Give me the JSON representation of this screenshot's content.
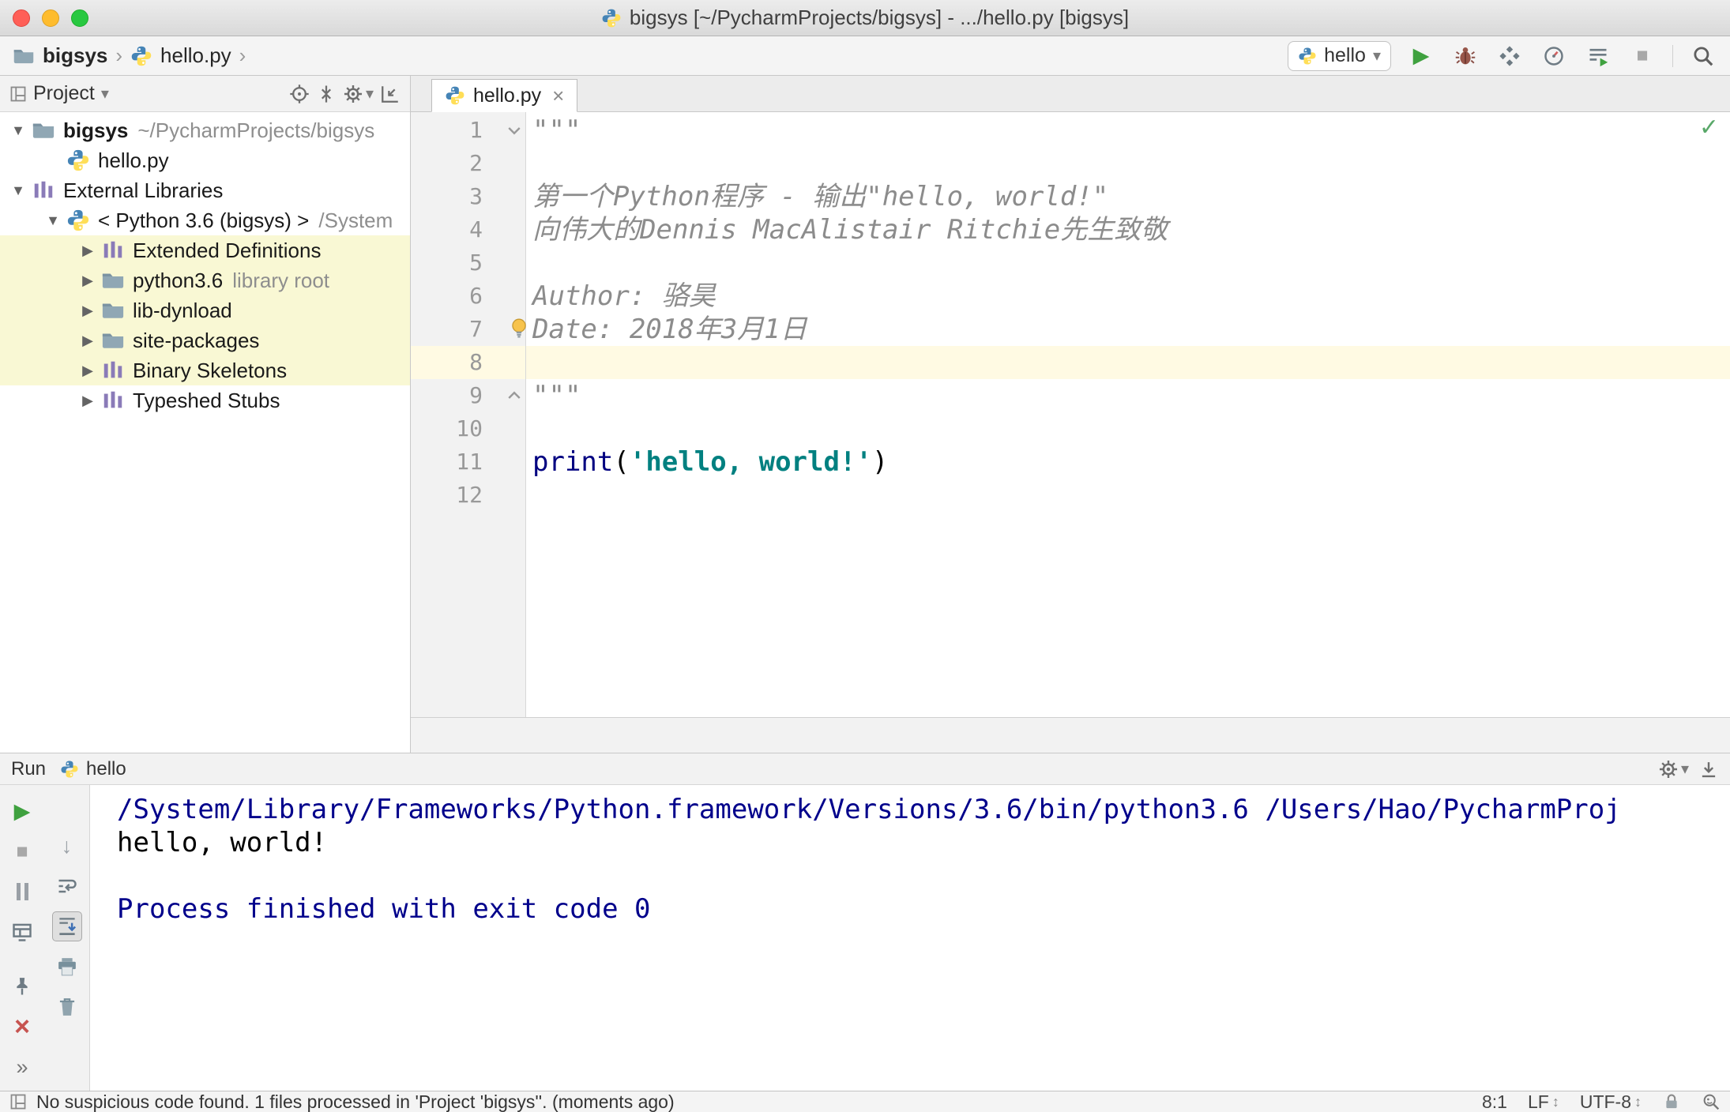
{
  "window": {
    "title": "bigsys [~/PycharmProjects/bigsys] - .../hello.py [bigsys]"
  },
  "navbar": {
    "breadcrumb": [
      "bigsys",
      "hello.py"
    ],
    "run_config": "hello"
  },
  "project_panel": {
    "header": "Project",
    "tree": [
      {
        "label": "bigsys",
        "sub": "~/PycharmProjects/bigsys",
        "level": 0,
        "arrow": "down",
        "icon": "folder",
        "bold": true
      },
      {
        "label": "hello.py",
        "level": 1,
        "arrow": null,
        "icon": "python"
      },
      {
        "label": "External Libraries",
        "level": 0,
        "arrow": "down",
        "icon": "library"
      },
      {
        "label": "< Python 3.6 (bigsys) >",
        "sub": "/System",
        "level": 1,
        "arrow": "down",
        "icon": "python"
      },
      {
        "label": "Extended Definitions",
        "level": 2,
        "arrow": "right",
        "icon": "library",
        "highlight": true
      },
      {
        "label": "python3.6",
        "sub": "library root",
        "level": 2,
        "arrow": "right",
        "icon": "folder",
        "highlight": true
      },
      {
        "label": "lib-dynload",
        "level": 2,
        "arrow": "right",
        "icon": "folder",
        "highlight": true
      },
      {
        "label": "site-packages",
        "level": 2,
        "arrow": "right",
        "icon": "folder",
        "highlight": true
      },
      {
        "label": "Binary Skeletons",
        "level": 2,
        "arrow": "right",
        "icon": "library",
        "highlight": true
      },
      {
        "label": "Typeshed Stubs",
        "level": 2,
        "arrow": "right",
        "icon": "library",
        "highlight": false
      }
    ]
  },
  "editor": {
    "tab": "hello.py",
    "lines": [
      {
        "n": 1,
        "fold": "start",
        "seg": [
          {
            "t": "\"\"\"",
            "s": "doc"
          }
        ]
      },
      {
        "n": 2,
        "seg": []
      },
      {
        "n": 3,
        "seg": [
          {
            "t": "第一个Python程序 - 输出\"hello, world!\"",
            "s": "doc"
          }
        ]
      },
      {
        "n": 4,
        "seg": [
          {
            "t": "向伟大的Dennis MacAlistair Ritchie先生致敬",
            "s": "doc"
          }
        ]
      },
      {
        "n": 5,
        "seg": []
      },
      {
        "n": 6,
        "seg": [
          {
            "t": "Author: 骆昊",
            "s": "doc"
          }
        ]
      },
      {
        "n": 7,
        "bulb": true,
        "seg": [
          {
            "t": "Date: 2018年3月1日",
            "s": "doc"
          }
        ]
      },
      {
        "n": 8,
        "current": true,
        "seg": []
      },
      {
        "n": 9,
        "fold": "end",
        "seg": [
          {
            "t": "\"\"\"",
            "s": "doc"
          }
        ]
      },
      {
        "n": 10,
        "seg": []
      },
      {
        "n": 11,
        "seg": [
          {
            "t": "print",
            "s": "kw"
          },
          {
            "t": "(",
            "s": "pl"
          },
          {
            "t": "'hello, world!'",
            "s": "str"
          },
          {
            "t": ")",
            "s": "pl"
          }
        ]
      },
      {
        "n": 12,
        "seg": []
      }
    ]
  },
  "run_panel": {
    "title": "Run",
    "tab": "hello",
    "console": [
      {
        "t": "/System/Library/Frameworks/Python.framework/Versions/3.6/bin/python3.6 /Users/Hao/PycharmProj",
        "s": "sys"
      },
      {
        "t": "hello, world!",
        "s": "out"
      },
      {
        "t": "",
        "s": "out"
      },
      {
        "t": "Process finished with exit code 0",
        "s": "sys"
      }
    ]
  },
  "statusbar": {
    "message": "No suspicious code found. 1 files processed in 'Project 'bigsys''. (moments ago)",
    "caret": "8:1",
    "line_ending": "LF",
    "encoding": "UTF-8"
  },
  "icons": {
    "run": "▶",
    "stop": "■",
    "close": "×",
    "more": "»",
    "dropdown": "▾",
    "breadcrumb_sep": "›",
    "check": "✓",
    "down_arrow": "↓",
    "updown": "↕",
    "expand_down": "▼",
    "expand_right": "▶"
  },
  "colors": {
    "run_green": "#3fa13f",
    "debug_red": "#97564a",
    "keyword": "#000080",
    "string": "#008080",
    "docstring": "#8c8c8c",
    "console_system": "#00008b",
    "current_line": "#fffae3",
    "tree_highlight": "#f9f8d4",
    "check_green": "#59a869"
  }
}
